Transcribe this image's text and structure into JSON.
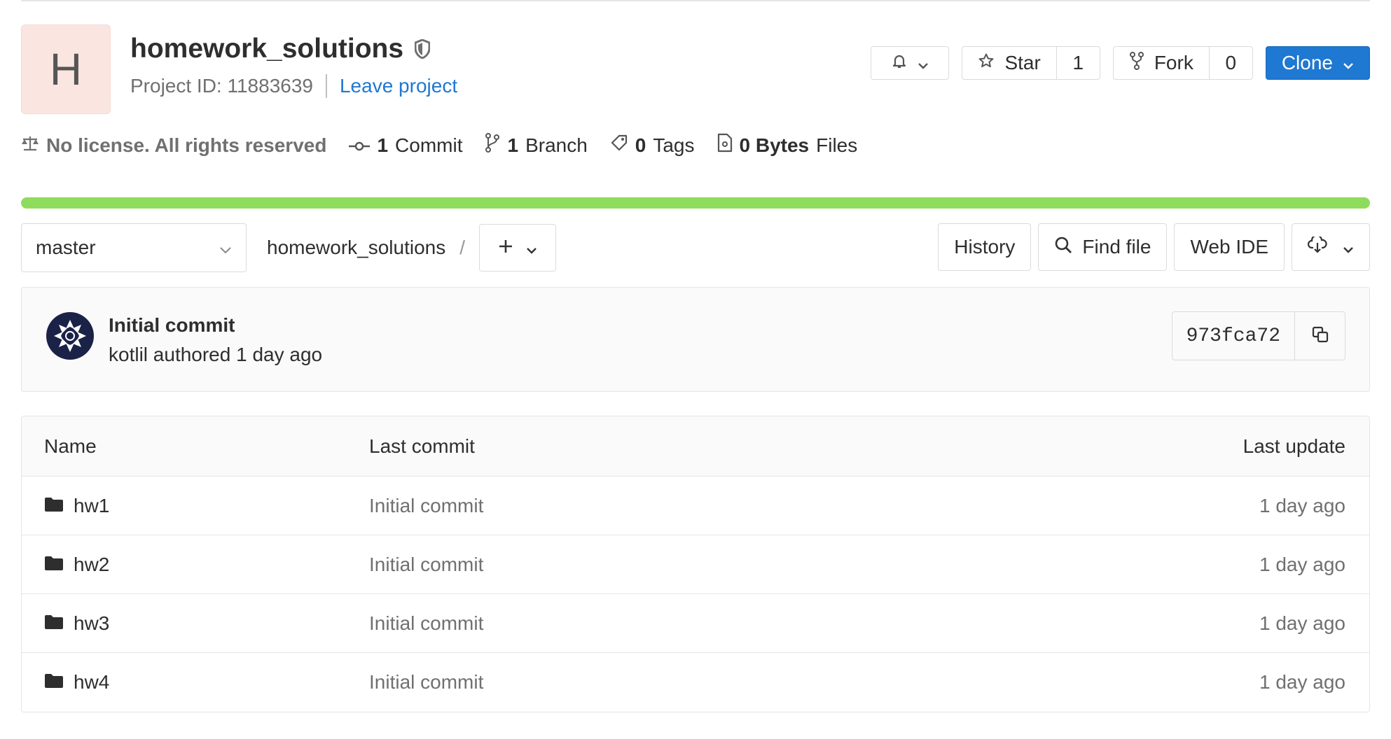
{
  "project": {
    "avatar_letter": "H",
    "name": "homework_solutions",
    "id_label": "Project ID: 11883639",
    "leave_link": "Leave project"
  },
  "header_buttons": {
    "star_label": "Star",
    "star_count": "1",
    "fork_label": "Fork",
    "fork_count": "0",
    "clone_label": "Clone"
  },
  "stats": {
    "license": "No license. All rights reserved",
    "commits_count": "1",
    "commits_label": "Commit",
    "branches_count": "1",
    "branches_label": "Branch",
    "tags_count": "0",
    "tags_label": "Tags",
    "files_count": "0 Bytes",
    "files_label": "Files"
  },
  "toolbar": {
    "branch": "master",
    "path_root": "homework_solutions",
    "path_sep": "/",
    "history": "History",
    "find_file": "Find file",
    "web_ide": "Web IDE"
  },
  "last_commit": {
    "title": "Initial commit",
    "author_line": "kotlil authored 1 day ago",
    "sha": "973fca72"
  },
  "file_table": {
    "headers": {
      "name": "Name",
      "last_commit": "Last commit",
      "last_update": "Last update"
    },
    "rows": [
      {
        "name": "hw1",
        "commit": "Initial commit",
        "updated": "1 day ago"
      },
      {
        "name": "hw2",
        "commit": "Initial commit",
        "updated": "1 day ago"
      },
      {
        "name": "hw3",
        "commit": "Initial commit",
        "updated": "1 day ago"
      },
      {
        "name": "hw4",
        "commit": "Initial commit",
        "updated": "1 day ago"
      }
    ]
  },
  "colors": {
    "accent": "#1f78d1",
    "language_bar": "#8fdc5d",
    "avatar_bg": "#fbe5e1"
  }
}
